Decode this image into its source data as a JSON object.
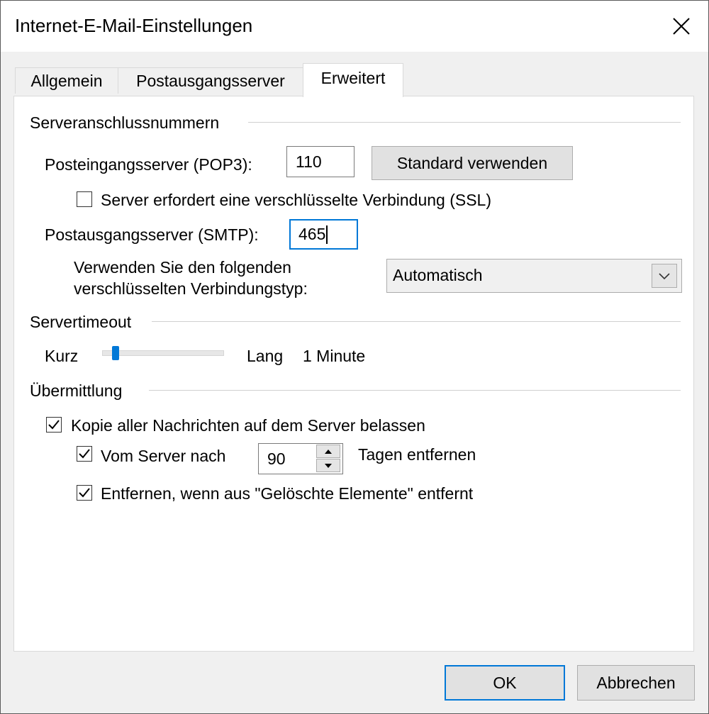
{
  "window": {
    "title": "Internet-E-Mail-Einstellungen"
  },
  "tabs": [
    {
      "label": "Allgemein"
    },
    {
      "label": "Postausgangsserver"
    },
    {
      "label": "Erweitert"
    }
  ],
  "ports": {
    "group_title": "Serveranschlussnummern",
    "pop3_label": "Posteingangsserver (POP3):",
    "pop3_value": "110",
    "default_button": "Standard verwenden",
    "ssl_checkbox_label": "Server erfordert eine verschlüsselte Verbindung (SSL)",
    "ssl_checked": false,
    "smtp_label": "Postausgangsserver (SMTP):",
    "smtp_value": "465",
    "encryption_label_line1": "Verwenden Sie den folgenden",
    "encryption_label_line2": "verschlüsselten Verbindungstyp:",
    "encryption_value": "Automatisch"
  },
  "timeout": {
    "group_title": "Servertimeout",
    "short_label": "Kurz",
    "long_label": "Lang",
    "value_text": "1 Minute"
  },
  "delivery": {
    "group_title": "Übermittlung",
    "leave_copy_label": "Kopie aller Nachrichten auf dem Server belassen",
    "leave_copy_checked": true,
    "remove_after_label": "Vom Server nach",
    "remove_after_checked": true,
    "days_value": "90",
    "days_suffix": "Tagen entfernen",
    "remove_deleted_label": "Entfernen, wenn aus \"Gelöschte Elemente\" entfernt",
    "remove_deleted_checked": true
  },
  "footer": {
    "ok_label": "OK",
    "cancel_label": "Abbrechen"
  },
  "colors": {
    "accent": "#0078d7",
    "window_bg": "#f0f0f0",
    "panel_bg": "#ffffff"
  },
  "icons": {
    "close": "close-icon",
    "dropdown": "chevron-down-icon",
    "checkmark": "checkmark-icon",
    "spin_up": "arrow-up-icon",
    "spin_down": "arrow-down-icon"
  }
}
